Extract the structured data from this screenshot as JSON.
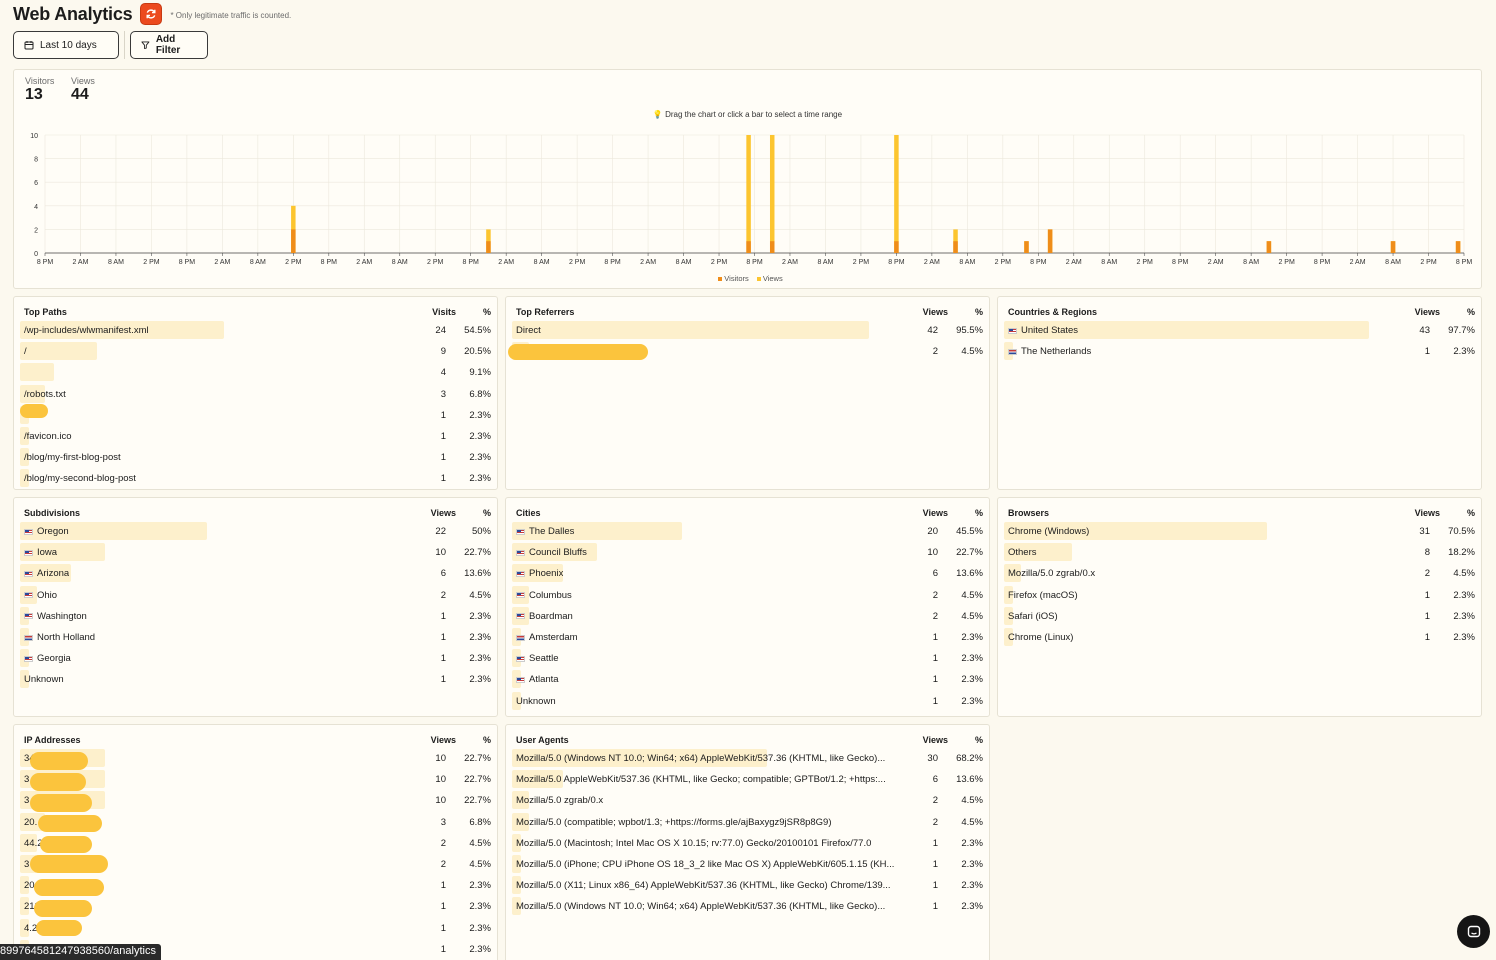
{
  "header": {
    "title": "Web Analytics",
    "note": "* Only legitimate traffic is counted.",
    "date_range": "Last 10 days",
    "add_filter": "Add Filter"
  },
  "summary": {
    "visitors_label": "Visitors",
    "visitors_value": "13",
    "views_label": "Views",
    "views_value": "44",
    "hint": "Drag the chart or click a bar to select a time range"
  },
  "chart_data": {
    "type": "bar",
    "ylim": [
      0,
      10
    ],
    "yticks": [
      0,
      2,
      4,
      6,
      8,
      10
    ],
    "xticks": [
      "8 PM",
      "2 AM",
      "8 AM",
      "2 PM",
      "8 PM",
      "2 AM",
      "8 AM",
      "2 PM",
      "8 PM",
      "2 AM",
      "8 AM",
      "2 PM",
      "8 PM",
      "2 AM",
      "8 AM",
      "2 PM",
      "8 PM",
      "2 AM",
      "8 AM",
      "2 PM",
      "8 PM",
      "2 AM",
      "8 AM",
      "2 PM",
      "8 PM",
      "2 AM",
      "8 AM",
      "2 PM",
      "8 PM",
      "2 AM",
      "8 AM",
      "2 PM",
      "8 PM",
      "2 AM",
      "8 AM",
      "2 PM",
      "8 PM",
      "2 AM",
      "8 AM",
      "2 PM",
      "8 PM"
    ],
    "grid": true,
    "legend": "bottom-center",
    "series": [
      {
        "name": "Visitors",
        "color": "#ef8d1a"
      },
      {
        "name": "Views",
        "color": "#fcc52f"
      }
    ],
    "bars": [
      {
        "hour": 42,
        "visitors": 2,
        "views": 4
      },
      {
        "hour": 75,
        "visitors": 1,
        "views": 2
      },
      {
        "hour": 119,
        "visitors": 1,
        "views": 10
      },
      {
        "hour": 123,
        "visitors": 1,
        "views": 10
      },
      {
        "hour": 144,
        "visitors": 1,
        "views": 10
      },
      {
        "hour": 154,
        "visitors": 1,
        "views": 2
      },
      {
        "hour": 166,
        "visitors": 1,
        "views": 1
      },
      {
        "hour": 170,
        "visitors": 2,
        "views": 2
      },
      {
        "hour": 207,
        "visitors": 1,
        "views": 1
      },
      {
        "hour": 228,
        "visitors": 1,
        "views": 1
      },
      {
        "hour": 239,
        "visitors": 1,
        "views": 1
      }
    ]
  },
  "tables": {
    "top_paths": {
      "title": "Top Paths",
      "col1": "Visits",
      "col2": "%",
      "rows": [
        {
          "label": "/wp-includes/wlwmanifest.xml",
          "v": "24",
          "p": "54.5%",
          "frac": 0.545
        },
        {
          "label": "/",
          "v": "9",
          "p": "20.5%",
          "frac": 0.205
        },
        {
          "label": "",
          "v": "4",
          "p": "9.1%",
          "frac": 0.091
        },
        {
          "label": "/robots.txt",
          "v": "3",
          "p": "6.8%",
          "frac": 0.068
        },
        {
          "label": "",
          "v": "1",
          "p": "2.3%",
          "frac": 0.023
        },
        {
          "label": "/favicon.ico",
          "v": "1",
          "p": "2.3%",
          "frac": 0.023
        },
        {
          "label": "/blog/my-first-blog-post",
          "v": "1",
          "p": "2.3%",
          "frac": 0.023
        },
        {
          "label": "/blog/my-second-blog-post",
          "v": "1",
          "p": "2.3%",
          "frac": 0.023
        }
      ]
    },
    "top_referrers": {
      "title": "Top Referrers",
      "col1": "Views",
      "col2": "%",
      "rows": [
        {
          "label": "Direct",
          "v": "42",
          "p": "95.5%",
          "frac": 0.955
        },
        {
          "label": "",
          "v": "2",
          "p": "4.5%",
          "frac": 0.045
        }
      ]
    },
    "countries": {
      "title": "Countries & Regions",
      "col1": "Views",
      "col2": "%",
      "rows": [
        {
          "label": "United States",
          "flag": "us",
          "v": "43",
          "p": "97.7%",
          "frac": 0.977
        },
        {
          "label": "The Netherlands",
          "flag": "nl",
          "v": "1",
          "p": "2.3%",
          "frac": 0.023
        }
      ]
    },
    "subdivisions": {
      "title": "Subdivisions",
      "col1": "Views",
      "col2": "%",
      "rows": [
        {
          "label": "Oregon",
          "flag": "us",
          "v": "22",
          "p": "50%",
          "frac": 0.5
        },
        {
          "label": "Iowa",
          "flag": "us",
          "v": "10",
          "p": "22.7%",
          "frac": 0.227
        },
        {
          "label": "Arizona",
          "flag": "us",
          "v": "6",
          "p": "13.6%",
          "frac": 0.136
        },
        {
          "label": "Ohio",
          "flag": "us",
          "v": "2",
          "p": "4.5%",
          "frac": 0.045
        },
        {
          "label": "Washington",
          "flag": "us",
          "v": "1",
          "p": "2.3%",
          "frac": 0.023
        },
        {
          "label": "North Holland",
          "flag": "nl",
          "v": "1",
          "p": "2.3%",
          "frac": 0.023
        },
        {
          "label": "Georgia",
          "flag": "us",
          "v": "1",
          "p": "2.3%",
          "frac": 0.023
        },
        {
          "label": "Unknown",
          "v": "1",
          "p": "2.3%",
          "frac": 0.023
        }
      ]
    },
    "cities": {
      "title": "Cities",
      "col1": "Views",
      "col2": "%",
      "rows": [
        {
          "label": "The Dalles",
          "flag": "us",
          "v": "20",
          "p": "45.5%",
          "frac": 0.455
        },
        {
          "label": "Council Bluffs",
          "flag": "us",
          "v": "10",
          "p": "22.7%",
          "frac": 0.227
        },
        {
          "label": "Phoenix",
          "flag": "us",
          "v": "6",
          "p": "13.6%",
          "frac": 0.136
        },
        {
          "label": "Columbus",
          "flag": "us",
          "v": "2",
          "p": "4.5%",
          "frac": 0.045
        },
        {
          "label": "Boardman",
          "flag": "us",
          "v": "2",
          "p": "4.5%",
          "frac": 0.045
        },
        {
          "label": "Amsterdam",
          "flag": "nl",
          "v": "1",
          "p": "2.3%",
          "frac": 0.023
        },
        {
          "label": "Seattle",
          "flag": "us",
          "v": "1",
          "p": "2.3%",
          "frac": 0.023
        },
        {
          "label": "Atlanta",
          "flag": "us",
          "v": "1",
          "p": "2.3%",
          "frac": 0.023
        },
        {
          "label": "Unknown",
          "v": "1",
          "p": "2.3%",
          "frac": 0.023
        }
      ]
    },
    "browsers": {
      "title": "Browsers",
      "col1": "Views",
      "col2": "%",
      "rows": [
        {
          "label": "Chrome (Windows)",
          "v": "31",
          "p": "70.5%",
          "frac": 0.705
        },
        {
          "label": "Others",
          "v": "8",
          "p": "18.2%",
          "frac": 0.182
        },
        {
          "label": "Mozilla/5.0 zgrab/0.x",
          "v": "2",
          "p": "4.5%",
          "frac": 0.045
        },
        {
          "label": "Firefox (macOS)",
          "v": "1",
          "p": "2.3%",
          "frac": 0.023
        },
        {
          "label": "Safari (iOS)",
          "v": "1",
          "p": "2.3%",
          "frac": 0.023
        },
        {
          "label": "Chrome (Linux)",
          "v": "1",
          "p": "2.3%",
          "frac": 0.023
        }
      ]
    },
    "ip_addresses": {
      "title": "IP Addresses",
      "col1": "Views",
      "col2": "%",
      "rows": [
        {
          "label": "34",
          "v": "10",
          "p": "22.7%",
          "frac": 0.227
        },
        {
          "label": "3",
          "v": "10",
          "p": "22.7%",
          "frac": 0.227
        },
        {
          "label": "3",
          "v": "10",
          "p": "22.7%",
          "frac": 0.227
        },
        {
          "label": "20.",
          "v": "3",
          "p": "6.8%",
          "frac": 0.068
        },
        {
          "label": "44.2",
          "v": "2",
          "p": "4.5%",
          "frac": 0.045
        },
        {
          "label": "3",
          "v": "2",
          "p": "4.5%",
          "frac": 0.045
        },
        {
          "label": "20",
          "v": "1",
          "p": "2.3%",
          "frac": 0.023
        },
        {
          "label": "212",
          "v": "1",
          "p": "2.3%",
          "frac": 0.023
        },
        {
          "label": "4.2",
          "v": "1",
          "p": "2.3%",
          "frac": 0.023
        },
        {
          "label": "",
          "v": "1",
          "p": "2.3%",
          "frac": 0.023
        }
      ]
    },
    "user_agents": {
      "title": "User Agents",
      "col1": "Views",
      "col2": "%",
      "rows": [
        {
          "label": "Mozilla/5.0 (Windows NT 10.0; Win64; x64) AppleWebKit/537.36 (KHTML, like Gecko)...",
          "v": "30",
          "p": "68.2%",
          "frac": 0.682
        },
        {
          "label": "Mozilla/5.0 AppleWebKit/537.36 (KHTML, like Gecko; compatible; GPTBot/1.2; +https:...",
          "v": "6",
          "p": "13.6%",
          "frac": 0.136
        },
        {
          "label": "Mozilla/5.0 zgrab/0.x",
          "v": "2",
          "p": "4.5%",
          "frac": 0.045
        },
        {
          "label": "Mozilla/5.0 (compatible; wpbot/1.3; +https://forms.gle/ajBaxygz9jSR8p8G9)",
          "v": "2",
          "p": "4.5%",
          "frac": 0.045
        },
        {
          "label": "Mozilla/5.0 (Macintosh; Intel Mac OS X 10.15; rv:77.0) Gecko/20100101 Firefox/77.0",
          "v": "1",
          "p": "2.3%",
          "frac": 0.023
        },
        {
          "label": "Mozilla/5.0 (iPhone; CPU iPhone OS 18_3_2 like Mac OS X) AppleWebKit/605.1.15 (KH...",
          "v": "1",
          "p": "2.3%",
          "frac": 0.023
        },
        {
          "label": "Mozilla/5.0 (X11; Linux x86_64) AppleWebKit/537.36 (KHTML, like Gecko) Chrome/139...",
          "v": "1",
          "p": "2.3%",
          "frac": 0.023
        },
        {
          "label": "Mozilla/5.0 (Windows NT 10.0; Win64; x64) AppleWebKit/537.36 (KHTML, like Gecko)...",
          "v": "1",
          "p": "2.3%",
          "frac": 0.023
        }
      ]
    }
  },
  "status_url": "8997645812479385​60/analytics"
}
